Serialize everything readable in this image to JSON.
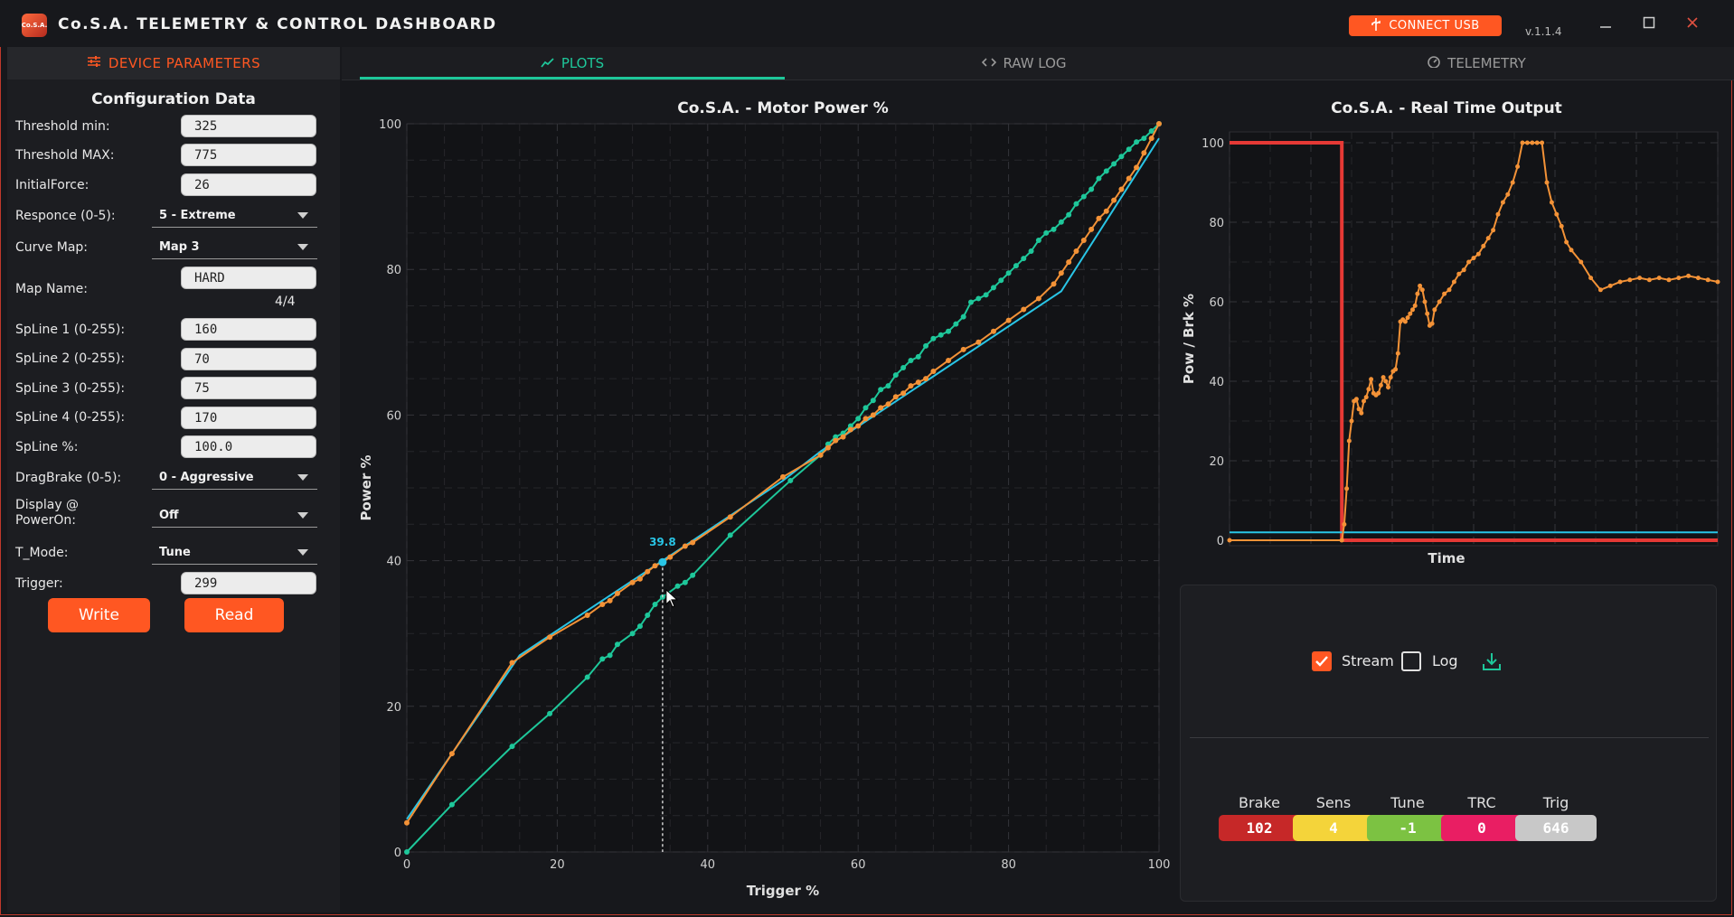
{
  "app": {
    "logo_text": "Co.S.A.",
    "title": "Co.S.A. TELEMETRY & CONTROL DASHBOARD",
    "connect_label": "CONNECT USB",
    "version": "v.1.1.4"
  },
  "left": {
    "header": "DEVICE PARAMETERS",
    "config_title": "Configuration Data",
    "fields": {
      "threshold_min": {
        "label": "Threshold min:",
        "value": "325"
      },
      "threshold_max": {
        "label": "Threshold MAX:",
        "value": "775"
      },
      "initial_force": {
        "label": "InitialForce:",
        "value": "26"
      },
      "responce": {
        "label": "Responce (0-5):",
        "value": "5 - Extreme"
      },
      "curve_map": {
        "label": "Curve Map:",
        "value": "Map 3"
      },
      "map_name": {
        "label": "Map Name:",
        "value": "HARD",
        "count": "4/4"
      },
      "spline1": {
        "label": "SpLine 1 (0-255):",
        "value": "160"
      },
      "spline2": {
        "label": "SpLine 2 (0-255):",
        "value": "70"
      },
      "spline3": {
        "label": "SpLine 3 (0-255):",
        "value": "75"
      },
      "spline4": {
        "label": "SpLine 4 (0-255):",
        "value": "170"
      },
      "spline_pct": {
        "label": "SpLine %:",
        "value": "100.0"
      },
      "dragbrake": {
        "label": "DragBrake (0-5):",
        "value": "0 - Aggressive"
      },
      "display_line1": "Display @",
      "display_line2": "PowerOn:",
      "display_value": "Off",
      "t_mode": {
        "label": "T_Mode:",
        "value": "Tune"
      },
      "trigger": {
        "label": "Trigger:",
        "value": "299"
      }
    },
    "write_label": "Write",
    "read_label": "Read"
  },
  "tabs": [
    {
      "label": "PLOTS",
      "active": true
    },
    {
      "label": "RAW LOG",
      "active": false
    },
    {
      "label": "TELEMETRY",
      "active": false
    }
  ],
  "controls": {
    "stream_label": "Stream",
    "stream_checked": true,
    "log_label": "Log",
    "log_checked": false,
    "badges": [
      {
        "label": "Brake",
        "value": "102",
        "color": "#c62828",
        "text_color": "#ffffff"
      },
      {
        "label": "Sens",
        "value": "4",
        "color": "#f4d43a",
        "text_color": "#ffffff"
      },
      {
        "label": "Tune",
        "value": "-1",
        "color": "#7cc242",
        "text_color": "#ffffff"
      },
      {
        "label": "TRC",
        "value": "0",
        "color": "#e91e63",
        "text_color": "#ffffff"
      },
      {
        "label": "Trig",
        "value": "646",
        "color": "#c8c8c8",
        "text_color": "#ffffff"
      }
    ]
  },
  "colors": {
    "accent": "#ff5722",
    "teal": "#1ec79a",
    "cyan": "#29c5e6",
    "orange_series": "#f39237",
    "red_series": "#e53935"
  },
  "chart_data": [
    {
      "type": "line",
      "title": "Co.S.A. - Motor Power %",
      "xlabel": "Trigger %",
      "ylabel": "Power %",
      "xlim": [
        0,
        100
      ],
      "ylim": [
        0,
        100
      ],
      "xticks": [
        "0",
        "20",
        "40",
        "60",
        "80",
        "100"
      ],
      "yticks": [
        "0",
        "20",
        "40",
        "60",
        "80",
        "100"
      ],
      "grid": true,
      "cursor": {
        "x": 34,
        "y": 39.8,
        "label": "39.8"
      },
      "series": [
        {
          "color": "#1ec79a",
          "markers": true,
          "x": [
            0,
            6,
            14,
            19,
            24,
            26,
            27,
            28,
            30,
            31,
            32,
            33,
            34,
            36,
            37,
            38,
            43,
            51,
            55,
            56,
            57,
            58,
            59,
            60,
            61,
            62,
            63,
            64,
            65,
            66,
            67,
            68,
            69,
            70,
            71,
            72,
            73,
            74,
            75,
            76,
            77,
            78,
            79,
            80,
            81,
            82,
            83,
            84,
            85,
            86,
            87,
            88,
            89,
            90,
            91,
            92,
            93,
            94,
            95,
            96,
            97,
            98,
            99,
            100
          ],
          "y": [
            0,
            6.5,
            14.5,
            19,
            24,
            26.5,
            27,
            28.5,
            30,
            31,
            32.5,
            34,
            35,
            36.5,
            37,
            38,
            43.5,
            51,
            54.5,
            56,
            57,
            57.5,
            58.5,
            59.5,
            61,
            62,
            63.5,
            64,
            65.5,
            66.5,
            67.5,
            68,
            69.5,
            70.5,
            71,
            71.5,
            72.5,
            73.5,
            75.5,
            76,
            76.5,
            77.5,
            78.5,
            79.5,
            80.5,
            81.5,
            82.5,
            84,
            85,
            85.5,
            86.5,
            87.5,
            89,
            90,
            91,
            92.5,
            93.5,
            94.5,
            95.5,
            96.5,
            97.5,
            98,
            99,
            100
          ]
        },
        {
          "color": "#29c5e6",
          "markers": false,
          "x": [
            0,
            15,
            34,
            50,
            55,
            87,
            100
          ],
          "y": [
            4.5,
            27,
            40,
            51,
            55,
            77,
            98
          ]
        },
        {
          "color": "#f39237",
          "markers": true,
          "x": [
            0,
            6,
            14,
            19,
            24,
            26,
            27,
            28,
            30,
            31,
            32,
            33,
            34,
            35,
            37,
            38,
            43,
            50,
            55,
            56,
            57,
            58,
            59,
            60,
            61,
            62,
            63,
            64,
            65,
            66,
            67,
            68,
            69,
            70,
            72,
            74,
            76,
            78,
            80,
            82,
            84,
            86,
            87,
            88,
            89,
            90,
            91,
            92,
            93,
            94,
            95,
            96,
            97,
            98,
            99,
            100
          ],
          "y": [
            4,
            13.5,
            26,
            29.5,
            32.5,
            34,
            34.5,
            35.5,
            37,
            37.5,
            38.5,
            39.3,
            39.8,
            40.5,
            42,
            42.5,
            46,
            51.5,
            54.5,
            55.5,
            56.5,
            57,
            58,
            58.5,
            59.5,
            60,
            61,
            61.5,
            62.5,
            63,
            64,
            64.5,
            65,
            66,
            67.5,
            69,
            70,
            71.5,
            73,
            74.5,
            76,
            78,
            79.5,
            81,
            82.5,
            84,
            85.5,
            87,
            88,
            89.5,
            91,
            92.5,
            94,
            96,
            98,
            100
          ]
        }
      ]
    },
    {
      "type": "line",
      "title": "Co.S.A. - Real Time Output",
      "xlabel": "Time",
      "ylabel": "Pow / Brk %",
      "xlim": [
        0,
        100
      ],
      "ylim": [
        0,
        100
      ],
      "yticks": [
        "0",
        "20",
        "40",
        "60",
        "80",
        "100"
      ],
      "grid": true,
      "series": [
        {
          "color": "#e53935",
          "markers": false,
          "x": [
            0,
            23,
            23,
            100
          ],
          "y": [
            100,
            100,
            0,
            0
          ]
        },
        {
          "color": "#29c5e6",
          "markers": false,
          "x": [
            0,
            100
          ],
          "y": [
            2,
            2
          ]
        },
        {
          "color": "#f39237",
          "markers": true,
          "x": [
            0,
            23,
            23.5,
            24,
            24.5,
            25,
            25.5,
            26,
            26.5,
            27,
            27.5,
            28,
            28.5,
            29,
            29.5,
            30,
            30.5,
            31,
            31.5,
            32,
            32.5,
            33,
            33.5,
            34,
            34.5,
            35,
            35.5,
            36,
            36.5,
            37,
            37.5,
            38,
            38.5,
            39,
            39.5,
            40,
            40.5,
            41,
            41.5,
            42,
            43,
            44,
            45,
            46,
            47,
            48,
            49,
            50,
            51,
            52,
            53,
            54,
            55,
            56,
            57,
            58,
            59,
            60,
            61,
            62,
            63,
            64,
            65,
            66,
            67,
            68,
            69,
            70,
            72,
            74,
            76,
            78,
            80,
            82,
            84,
            86,
            88,
            90,
            92,
            94,
            96,
            98,
            100
          ],
          "y": [
            0,
            0,
            4,
            13,
            25,
            30,
            35,
            35.5,
            33,
            32,
            35,
            36,
            38,
            40.5,
            37,
            36.5,
            37,
            39,
            41,
            40,
            38.5,
            41,
            42.5,
            43,
            47,
            55,
            55.5,
            55,
            56,
            57,
            58,
            59,
            62,
            64,
            63,
            60,
            57,
            54,
            54.5,
            58,
            60,
            62,
            63,
            65,
            67,
            68,
            70,
            71,
            72,
            74,
            76,
            78,
            82,
            85,
            87,
            90,
            94,
            100,
            100,
            100,
            100,
            100,
            90,
            85,
            82,
            79,
            75,
            73,
            70,
            66,
            63,
            64,
            65,
            65.5,
            66,
            65.5,
            66,
            65.5,
            66,
            66.5,
            66,
            65.5,
            65
          ]
        }
      ]
    }
  ]
}
